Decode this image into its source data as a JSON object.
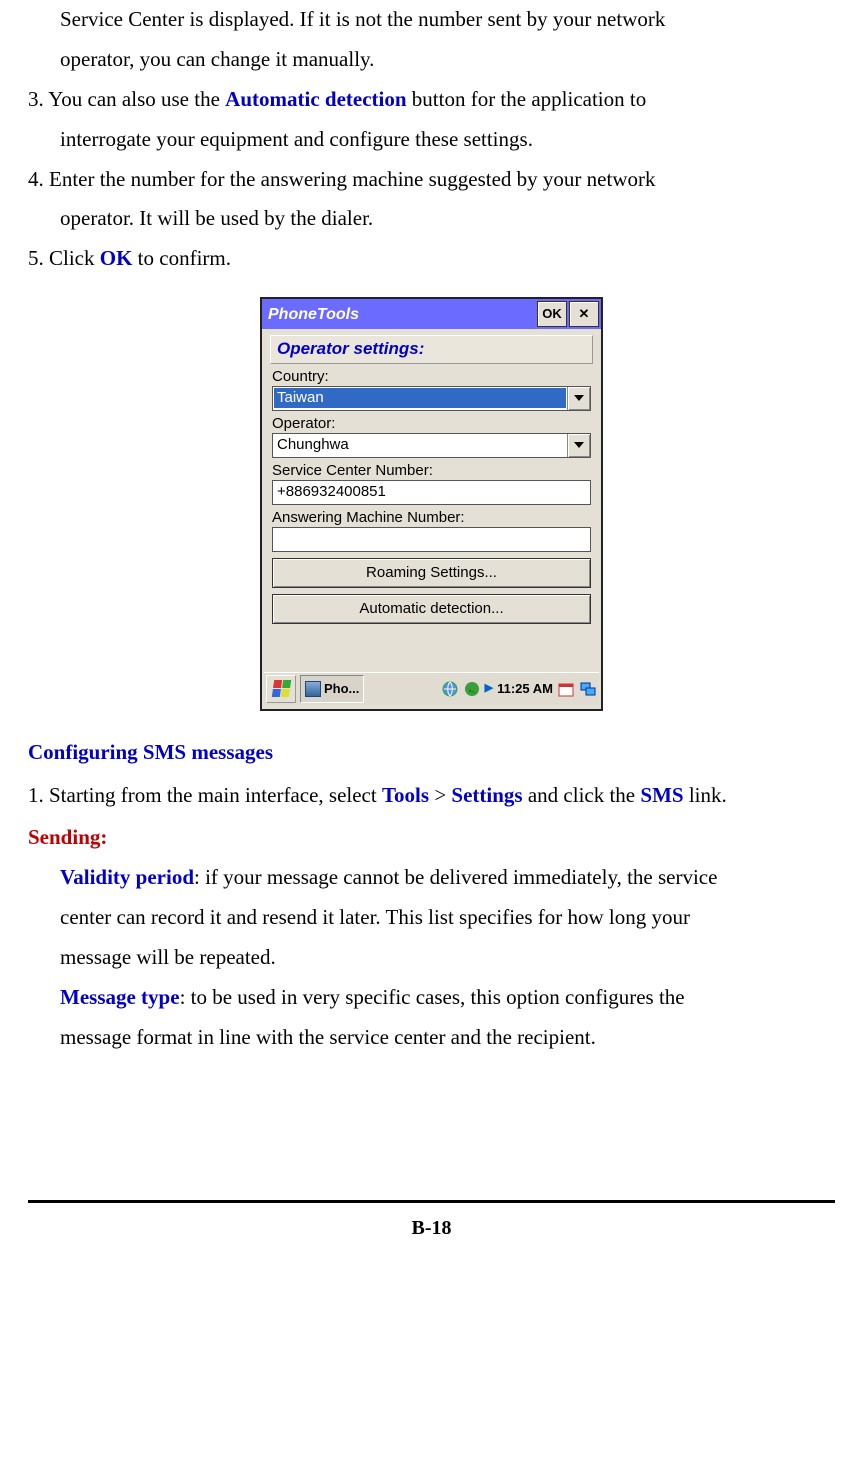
{
  "body": {
    "item2_continued_l1": "Service Center is displayed. If it is not the number sent by your network",
    "item2_continued_l2": "operator, you can change it manually.",
    "item3_prefix": "3. You can also use the ",
    "item3_bold": "Automatic detection",
    "item3_mid": " button for the application to",
    "item3_l2": "interrogate your equipment and configure these settings.",
    "item4_l1": "4. Enter the number for the answering machine suggested by your network",
    "item4_l2": "operator. It will be used by the dialer.",
    "item5_prefix": "5. Click ",
    "item5_bold": "OK",
    "item5_suffix": " to confirm."
  },
  "dialog": {
    "title": "PhoneTools",
    "ok_label": "OK",
    "section": "Operator settings:",
    "country_label": "Country:",
    "country_value": "Taiwan",
    "operator_label": "Operator:",
    "operator_value": "Chunghwa",
    "scn_label": "Service Center Number:",
    "scn_value": "+886932400851",
    "amn_label": "Answering Machine Number:",
    "amn_value": "",
    "roaming_btn": "Roaming Settings...",
    "auto_btn": "Automatic detection...",
    "taskbar_app": "Pho...",
    "taskbar_time": "11:25 AM"
  },
  "sms": {
    "heading": "Configuring SMS messages",
    "step1_prefix": "1. Starting from the main interface, select ",
    "tools": "Tools",
    "gt": " > ",
    "settings": "Settings",
    "mid": " and click the ",
    "sms_link": "SMS",
    "suffix": " link.",
    "sending_heading": "Sending:",
    "validity_bold": "Validity period",
    "validity_l1": ": if your message cannot be delivered immediately, the service",
    "validity_l2": "center can record it and resend it later. This list specifies for how long your",
    "validity_l3": "message will be repeated.",
    "msgtype_bold": "Message type",
    "msgtype_l1": ": to be used in very specific cases, this option configures the",
    "msgtype_l2": "message format in line with the service center and the recipient."
  },
  "footer": {
    "page_number": "B-18"
  }
}
